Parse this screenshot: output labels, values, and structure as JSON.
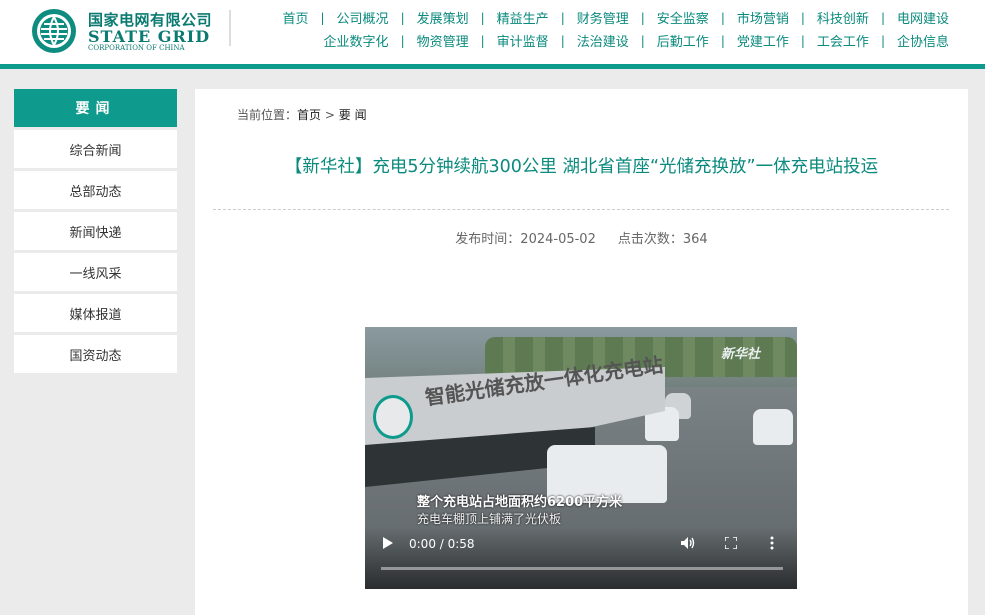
{
  "header": {
    "logo_cn": "国家电网有限公司",
    "logo_en": "STATE GRID",
    "logo_en_sub": "CORPORATION OF CHINA",
    "nav_row1": [
      "首页",
      "公司概况",
      "发展策划",
      "精益生产",
      "财务管理",
      "安全监察",
      "市场营销",
      "科技创新",
      "电网建设"
    ],
    "nav_row2": [
      "企业数字化",
      "物资管理",
      "审计监督",
      "法治建设",
      "后勤工作",
      "党建工作",
      "工会工作",
      "企协信息"
    ],
    "separator": "|"
  },
  "sidebar": {
    "title": "要闻",
    "items": [
      "综合新闻",
      "总部动态",
      "新闻快递",
      "一线风采",
      "媒体报道",
      "国资动态"
    ]
  },
  "breadcrumb": {
    "prefix": "当前位置：",
    "home": "首页",
    "arrow": ">",
    "current": "要 闻"
  },
  "article": {
    "title": "【新华社】充电5分钟续航300公里 湖北省首座“光储充换放”一体充电站投运",
    "publish_label": "发布时间：",
    "publish_date": "2024-05-02",
    "clicks_label": "点击次数：",
    "clicks": "364"
  },
  "video": {
    "sign_text": "智能光储充放一体化充电站",
    "watermark": "新华社",
    "subtitle1": "整个充电站占地面积约6200平方米",
    "subtitle2": "充电车棚顶上铺满了光伏板",
    "time": "0:00 / 0:58",
    "progress": 0
  },
  "colors": {
    "accent": "#0e9a8c",
    "nav_text": "#0b8a7e"
  }
}
